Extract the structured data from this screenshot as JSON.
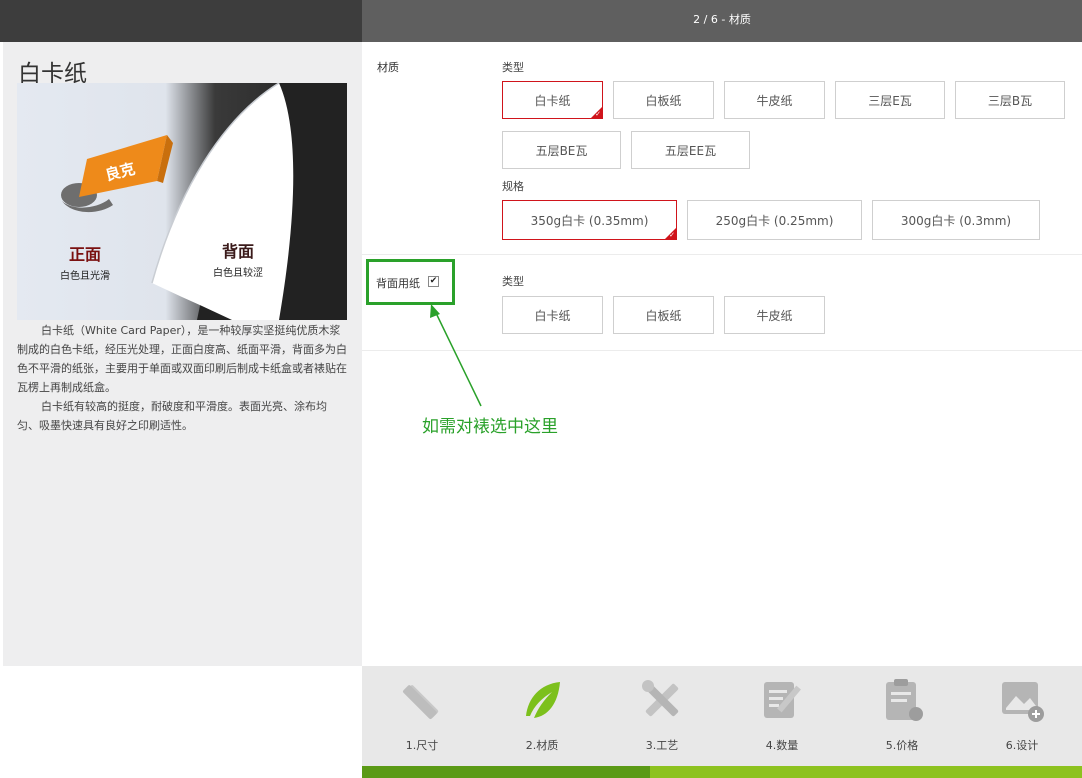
{
  "header": {
    "step_title": "2 / 6 - 材质"
  },
  "left": {
    "title": "白卡纸",
    "photo": {
      "front_title": "正面",
      "front_sub": "白色且光滑",
      "back_title": "背面",
      "back_sub": "白色且较涩",
      "logo_text": "良克"
    },
    "desc": [
      "白卡纸（White Card Paper），是一种较厚实坚挺纯优质木浆制成的白色卡纸，经压光处理，正面白度高、纸面平滑，背面多为白色不平滑的纸张，主要用于单面或双面印刷后制成卡纸盒或者裱贴在瓦楞上再制成纸盒。",
      "白卡纸有较高的挺度，耐破度和平滑度。表面光亮、涂布均匀、吸墨快速具有良好之印刷适性。"
    ]
  },
  "material": {
    "label": "材质",
    "type_label": "类型",
    "types": [
      "白卡纸",
      "白板纸",
      "牛皮纸",
      "三层E瓦",
      "三层B瓦",
      "五层BE瓦",
      "五层EE瓦"
    ],
    "selected_type": "白卡纸",
    "spec_label": "规格",
    "specs": [
      "350g白卡 (0.35mm)",
      "250g白卡 (0.25mm)",
      "300g白卡 (0.3mm)"
    ],
    "selected_spec": "350g白卡 (0.35mm)"
  },
  "back_paper": {
    "label": "背面用纸",
    "checked": true,
    "type_label": "类型",
    "types": [
      "白卡纸",
      "白板纸",
      "牛皮纸"
    ]
  },
  "annotation": {
    "text": "如需对裱选中这里",
    "color": "#2aa12a"
  },
  "steps": [
    {
      "label": "1.尺寸",
      "icon": "pencil-ruler-icon",
      "active": false
    },
    {
      "label": "2.材质",
      "icon": "feather-icon",
      "active": true
    },
    {
      "label": "3.工艺",
      "icon": "tools-icon",
      "active": false
    },
    {
      "label": "4.数量",
      "icon": "edit-document-icon",
      "active": false
    },
    {
      "label": "5.价格",
      "icon": "clipboard-icon",
      "active": false
    },
    {
      "label": "6.设计",
      "icon": "image-add-icon",
      "active": false
    }
  ],
  "progress": {
    "fraction": 0.4
  },
  "colors": {
    "accent": "#d0141b",
    "green": "#2aa12a",
    "progress_done": "#5b9a16",
    "progress_rest": "#8dc21f"
  }
}
